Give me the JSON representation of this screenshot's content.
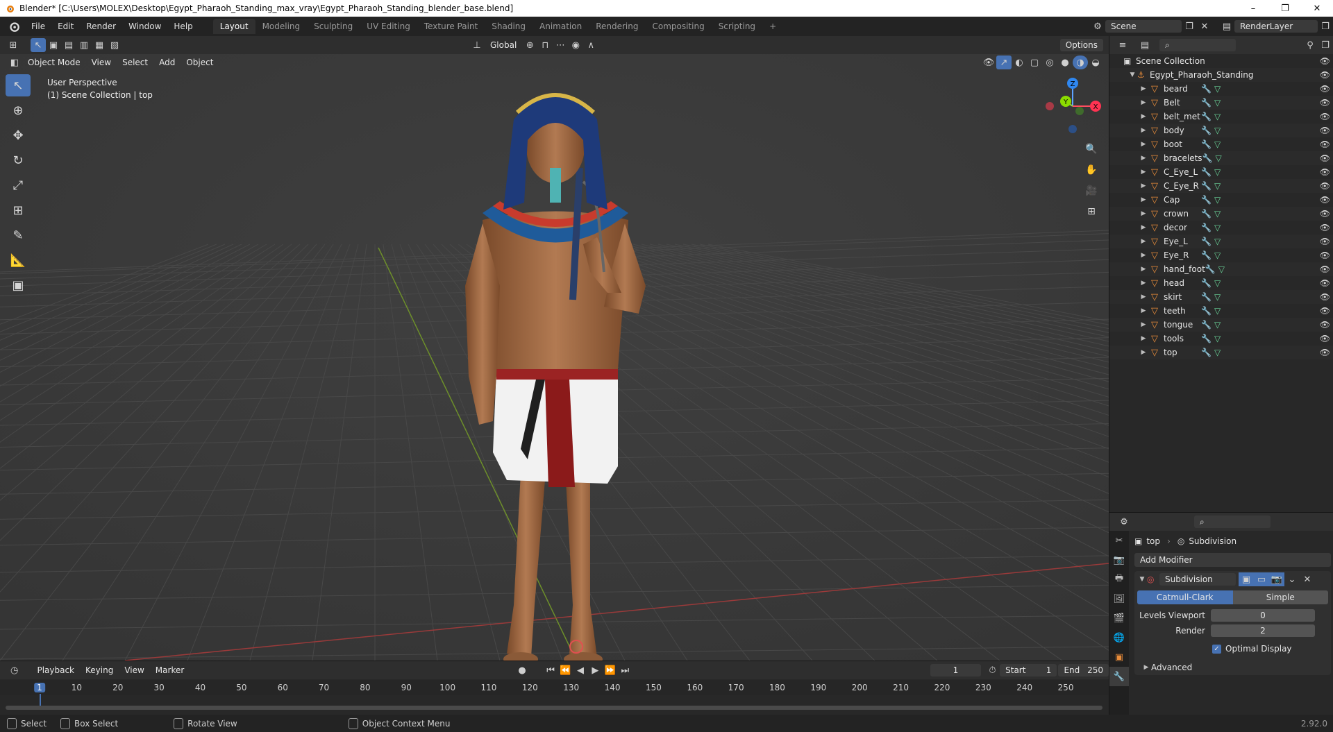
{
  "window": {
    "title": "Blender* [C:\\Users\\MOLEX\\Desktop\\Egypt_Pharaoh_Standing_max_vray\\Egypt_Pharaoh_Standing_blender_base.blend]",
    "controls": [
      "–",
      "❐",
      "✕"
    ]
  },
  "menu": [
    "File",
    "Edit",
    "Render",
    "Window",
    "Help"
  ],
  "workspaces": [
    {
      "label": "Layout",
      "active": true
    },
    {
      "label": "Modeling"
    },
    {
      "label": "Sculpting"
    },
    {
      "label": "UV Editing"
    },
    {
      "label": "Texture Paint"
    },
    {
      "label": "Shading"
    },
    {
      "label": "Animation"
    },
    {
      "label": "Rendering"
    },
    {
      "label": "Compositing"
    },
    {
      "label": "Scripting"
    }
  ],
  "add_workspace": "+",
  "scene": {
    "name": "Scene",
    "view_layer": "RenderLayer"
  },
  "viewport_header": {
    "transform_orientation": "Global",
    "options": "Options",
    "mode": "Object Mode",
    "menus": [
      "View",
      "Select",
      "Add",
      "Object"
    ]
  },
  "overlay_text": {
    "line1": "User Perspective",
    "line2": "(1) Scene Collection | top"
  },
  "gizmo": {
    "x": "X",
    "y": "Y",
    "z": "Z"
  },
  "outliner": {
    "root": "Scene Collection",
    "collection": "Egypt_Pharaoh_Standing",
    "objects": [
      "beard",
      "Belt",
      "belt_met",
      "body",
      "boot",
      "bracelets",
      "C_Eye_L",
      "C_Eye_R",
      "Cap",
      "crown",
      "decor",
      "Eye_L",
      "Eye_R",
      "hand_foot",
      "head",
      "skirt",
      "teeth",
      "tongue",
      "tools",
      "top"
    ]
  },
  "properties": {
    "object": "top",
    "modifier_breadcrumb": "Subdivision",
    "add_modifier": "Add Modifier",
    "modifier_name": "Subdivision",
    "type_options": [
      "Catmull-Clark",
      "Simple"
    ],
    "levels_viewport_label": "Levels Viewport",
    "levels_viewport": "0",
    "render_label": "Render",
    "render_value": "2",
    "optimal_display": "Optimal Display",
    "advanced": "Advanced"
  },
  "timeline": {
    "menus": [
      "Playback",
      "Keying",
      "View",
      "Marker"
    ],
    "current_frame": "1",
    "start_label": "Start",
    "start": "1",
    "end_label": "End",
    "end": "250",
    "ticks": [
      "1",
      "10",
      "20",
      "30",
      "40",
      "50",
      "60",
      "70",
      "80",
      "90",
      "100",
      "110",
      "120",
      "130",
      "140",
      "150",
      "160",
      "170",
      "180",
      "190",
      "200",
      "210",
      "220",
      "230",
      "240",
      "250"
    ]
  },
  "statusbar": {
    "select": "Select",
    "box_select": "Box Select",
    "rotate_view": "Rotate View",
    "context_menu": "Object Context Menu",
    "version": "2.92.0"
  }
}
